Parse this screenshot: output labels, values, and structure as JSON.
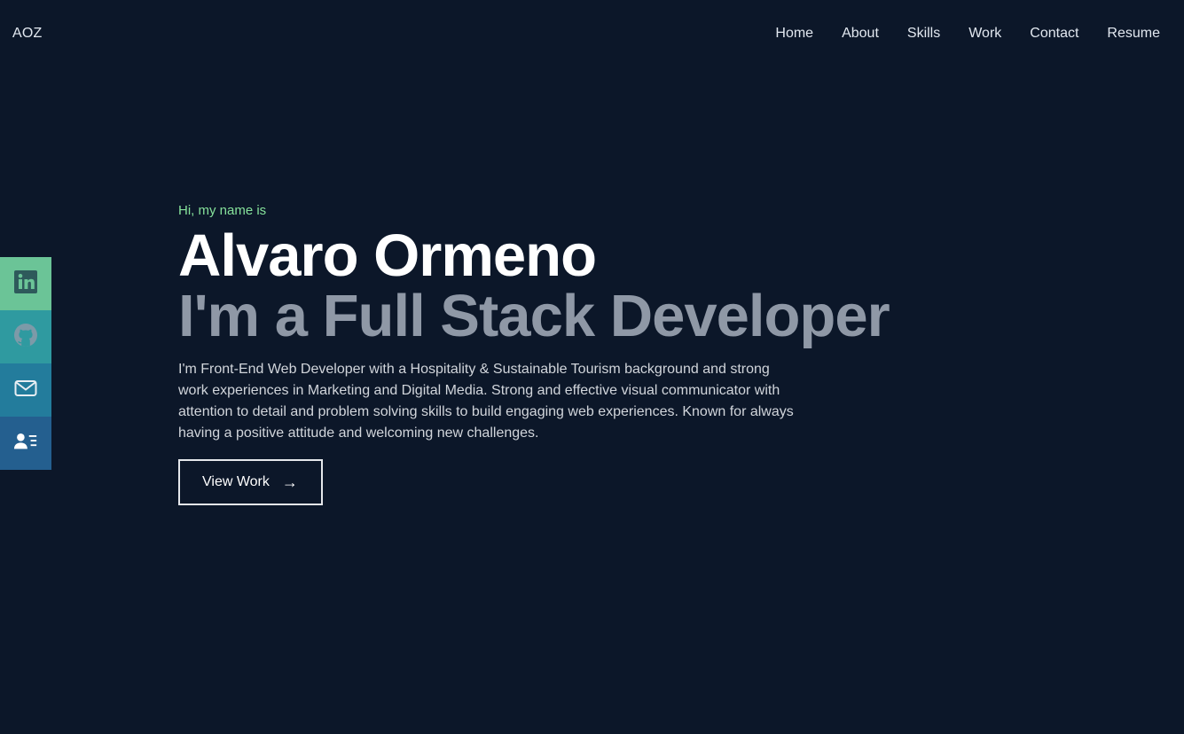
{
  "header": {
    "logo": "AOZ",
    "nav": [
      {
        "label": "Home"
      },
      {
        "label": "About"
      },
      {
        "label": "Skills"
      },
      {
        "label": "Work"
      },
      {
        "label": "Contact"
      },
      {
        "label": "Resume"
      }
    ]
  },
  "social": [
    {
      "icon": "linkedin-icon",
      "color": "#6bc497"
    },
    {
      "icon": "github-icon",
      "color": "#2f9aa0"
    },
    {
      "icon": "mail-icon",
      "color": "#237c9c"
    },
    {
      "icon": "contact-card-icon",
      "color": "#245f8f"
    }
  ],
  "hero": {
    "greeting": "Hi, my name is",
    "name": "Alvaro Ormeno",
    "role": "I'm a Full Stack Developer",
    "bio": "I'm Front-End Web Developer with a Hospitality & Sustainable Tourism background and strong work experiences in Marketing and Digital Media. Strong and effective visual communicator with attention to detail and problem solving skills to build engaging web experiences. Known for always having a positive attitude and welcoming new challenges.",
    "cta_label": "View Work",
    "cta_arrow": "→"
  },
  "colors": {
    "background": "#0c1729",
    "accent": "#86e29b",
    "role_text": "#8f98a6"
  }
}
